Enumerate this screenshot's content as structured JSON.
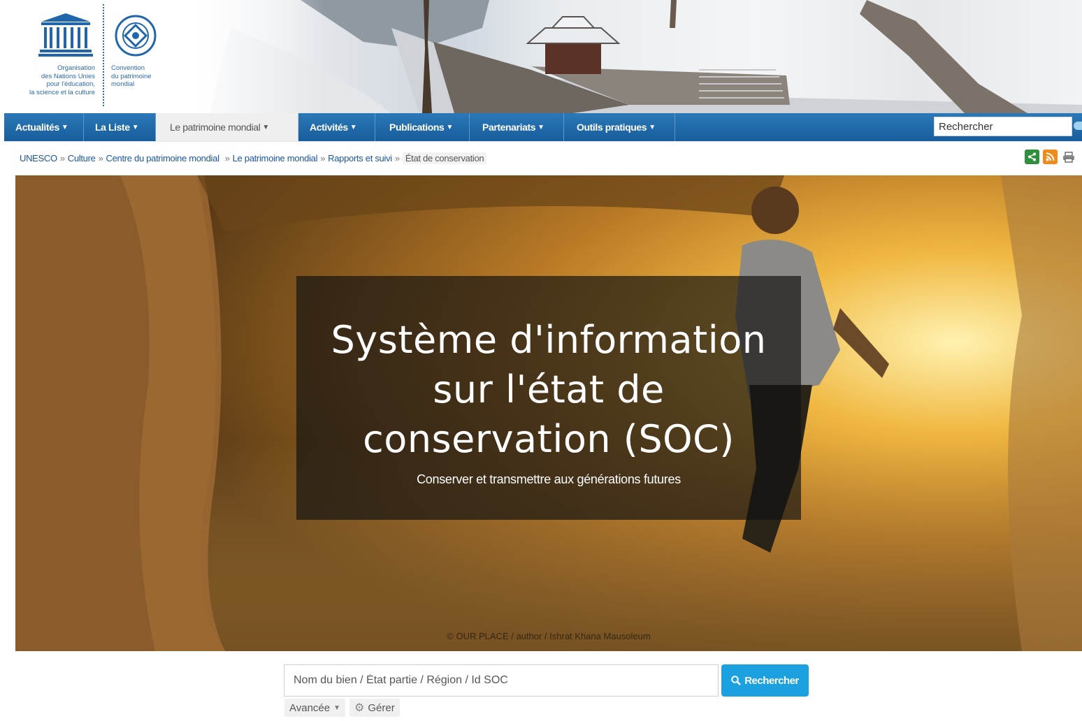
{
  "header": {
    "unesco_logo_text": "UNESCO",
    "unesco_caption": [
      "Organisation",
      "des Nations Unies",
      "pour l'éducation,",
      "la science et la culture"
    ],
    "whc_caption": [
      "Convention",
      "du patrimoine",
      "mondial"
    ]
  },
  "nav": {
    "items": [
      {
        "label": "Actualités",
        "active": false
      },
      {
        "label": "La Liste",
        "active": false
      },
      {
        "label": "Le patrimoine mondial",
        "active": true
      },
      {
        "label": "Activités",
        "active": false
      },
      {
        "label": "Publications",
        "active": false
      },
      {
        "label": "Partenariats",
        "active": false
      },
      {
        "label": "Outils pratiques",
        "active": false
      }
    ],
    "search_placeholder": "Rechercher"
  },
  "breadcrumb": {
    "items": [
      "UNESCO",
      "Culture",
      "Centre du patrimoine mondial",
      "Le patrimoine mondial",
      "Rapports et suivi"
    ],
    "separator": "»",
    "current": "État de conservation"
  },
  "hero": {
    "title": "Système d'information sur l'état de conservation (SOC)",
    "subtitle": "Conserver et transmettre aux générations futures",
    "credit": "© OUR PLACE / author / Ishrat Khana Mausoleum"
  },
  "search": {
    "placeholder": "Nom du bien / État partie / Région / Id SOC",
    "button_label": "Rechercher",
    "advanced_label": "Avancée",
    "manage_label": "Gérer"
  },
  "colors": {
    "nav_blue": "#1f6aa8",
    "link_blue": "#1a57a0",
    "button_blue": "#1ba0e0",
    "share_green": "#2f8f3c",
    "rss_orange": "#ef8b1a"
  }
}
